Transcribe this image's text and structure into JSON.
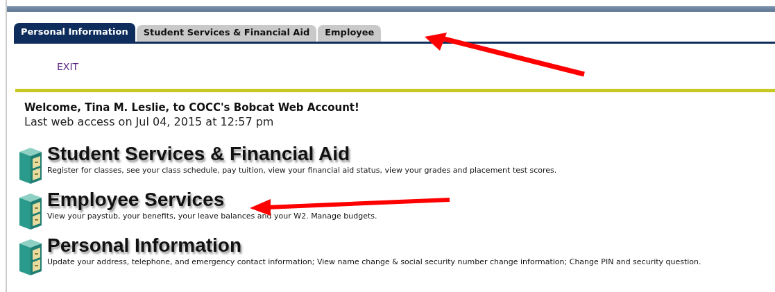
{
  "tabs": [
    {
      "label": "Personal Information",
      "selected": true
    },
    {
      "label": "Student Services & Financial Aid",
      "selected": false
    },
    {
      "label": "Employee",
      "selected": false
    }
  ],
  "exit_link": "EXIT",
  "welcome": {
    "greeting": "Welcome, Tina M. Leslie, to COCC's Bobcat Web Account!",
    "last_access": "Last web access on Jul 04, 2015 at 12:57 pm"
  },
  "sections": [
    {
      "title": "Student Services & Financial Aid",
      "description": "Register for classes, see your class schedule, pay tuition, view your financial aid status, view your grades and placement test scores."
    },
    {
      "title": "Employee Services",
      "description": "View your paystub, your benefits, your leave balances and your W2. Manage budgets."
    },
    {
      "title": "Personal Information",
      "description": "Update your address, telephone, and emergency contact information; View name change & social security number change information; Change PIN and security question."
    }
  ]
}
